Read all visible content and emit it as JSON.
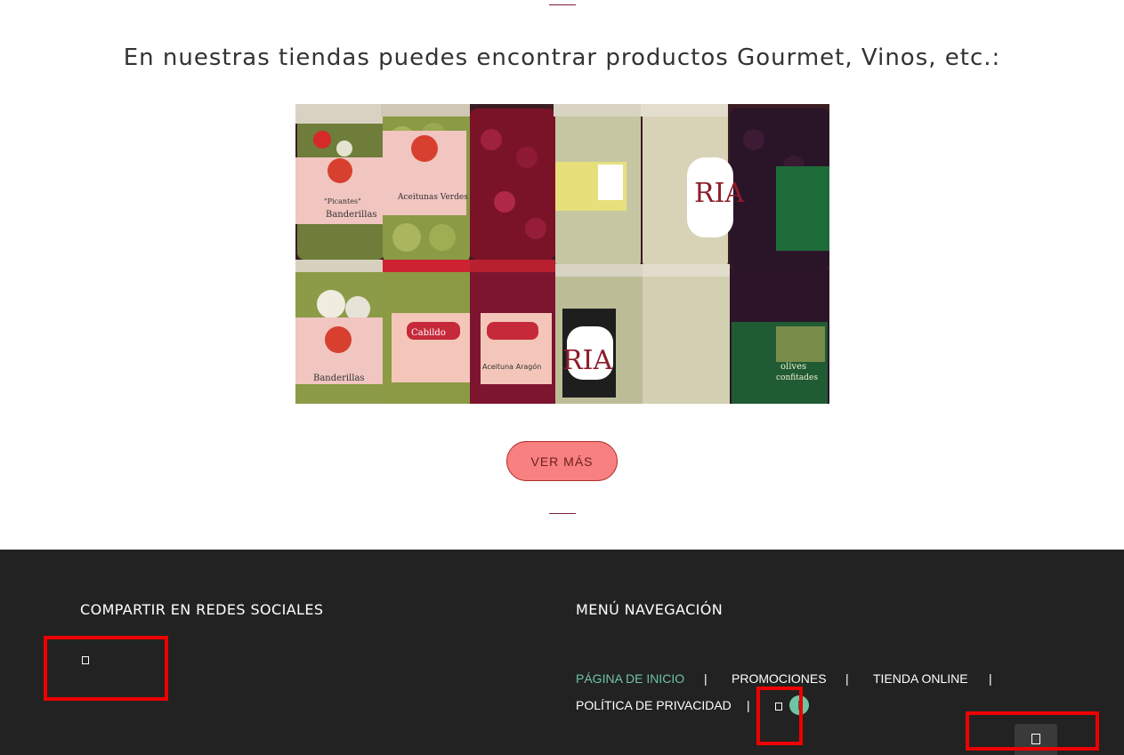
{
  "section": {
    "title": "En nuestras tiendas puedes encontrar productos Gourmet, Vinos, etc.:",
    "photo_labels": {
      "picantes": "\"Picantes\"",
      "banderillas": "Banderillas",
      "aceitunas_verdes": "Aceitunas Verdes",
      "ria": "RIA",
      "cabildo": "Cabildo",
      "aceituna_aragon": "Aceituna Aragón",
      "olives": "olives",
      "confitades": "confitades"
    },
    "more_button": "VER MÁS"
  },
  "footer": {
    "share_heading": "COMPARTIR EN REDES SOCIALES",
    "nav_heading": "MENÚ NAVEGACIÓN",
    "nav_links": [
      {
        "label": "PÁGINA DE INICIO",
        "active": true
      },
      {
        "label": "PROMOCIONES",
        "active": false
      },
      {
        "label": "TIENDA ONLINE",
        "active": false
      },
      {
        "label": "POLÍTICA DE PRIVACIDAD",
        "active": false
      }
    ],
    "separator": "|"
  },
  "colors": {
    "accent_green": "#6fc4a3",
    "button_pink": "#f88080",
    "footer_bg": "#222222",
    "highlight_red": "#ee0000"
  },
  "icons": [
    "share-icon",
    "social-icon",
    "chat-icon",
    "scroll-top-icon"
  ]
}
